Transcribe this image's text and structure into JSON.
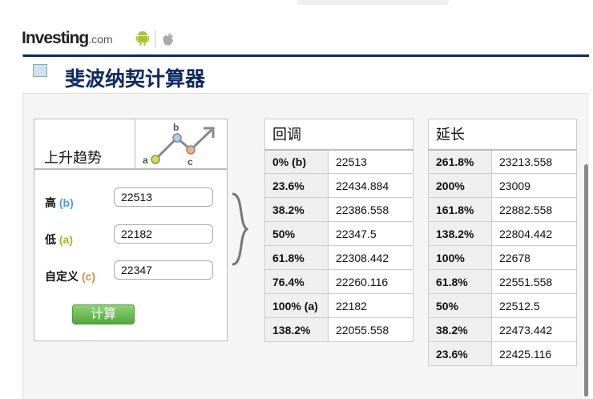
{
  "brand": {
    "name": "Investing",
    "suffix": ".com"
  },
  "title": "斐波纳契计算器",
  "panel": {
    "trend": "上升趋势",
    "diagram_labels": {
      "a": "a",
      "b": "b",
      "c": "c"
    },
    "fields": [
      {
        "label": "高",
        "tag": "(b)",
        "value": "22513",
        "color": "#4a9fd8"
      },
      {
        "label": "低",
        "tag": "(a)",
        "value": "22182",
        "color": "#a8b520"
      },
      {
        "label": "自定义",
        "tag": "(c)",
        "value": "22347",
        "color": "#e08a3c"
      }
    ],
    "button": "计算"
  },
  "retracement": {
    "header": "回调",
    "rows": [
      [
        "0% (b)",
        "22513"
      ],
      [
        "23.6%",
        "22434.884"
      ],
      [
        "38.2%",
        "22386.558"
      ],
      [
        "50%",
        "22347.5"
      ],
      [
        "61.8%",
        "22308.442"
      ],
      [
        "76.4%",
        "22260.116"
      ],
      [
        "100% (a)",
        "22182"
      ],
      [
        "138.2%",
        "22055.558"
      ]
    ]
  },
  "extension": {
    "header": "延长",
    "rows": [
      [
        "261.8%",
        "23213.558"
      ],
      [
        "200%",
        "23009"
      ],
      [
        "161.8%",
        "22882.558"
      ],
      [
        "138.2%",
        "22804.442"
      ],
      [
        "100%",
        "22678"
      ],
      [
        "61.8%",
        "22551.558"
      ],
      [
        "50%",
        "22512.5"
      ],
      [
        "38.2%",
        "22473.442"
      ],
      [
        "23.6%",
        "22425.116"
      ]
    ]
  }
}
